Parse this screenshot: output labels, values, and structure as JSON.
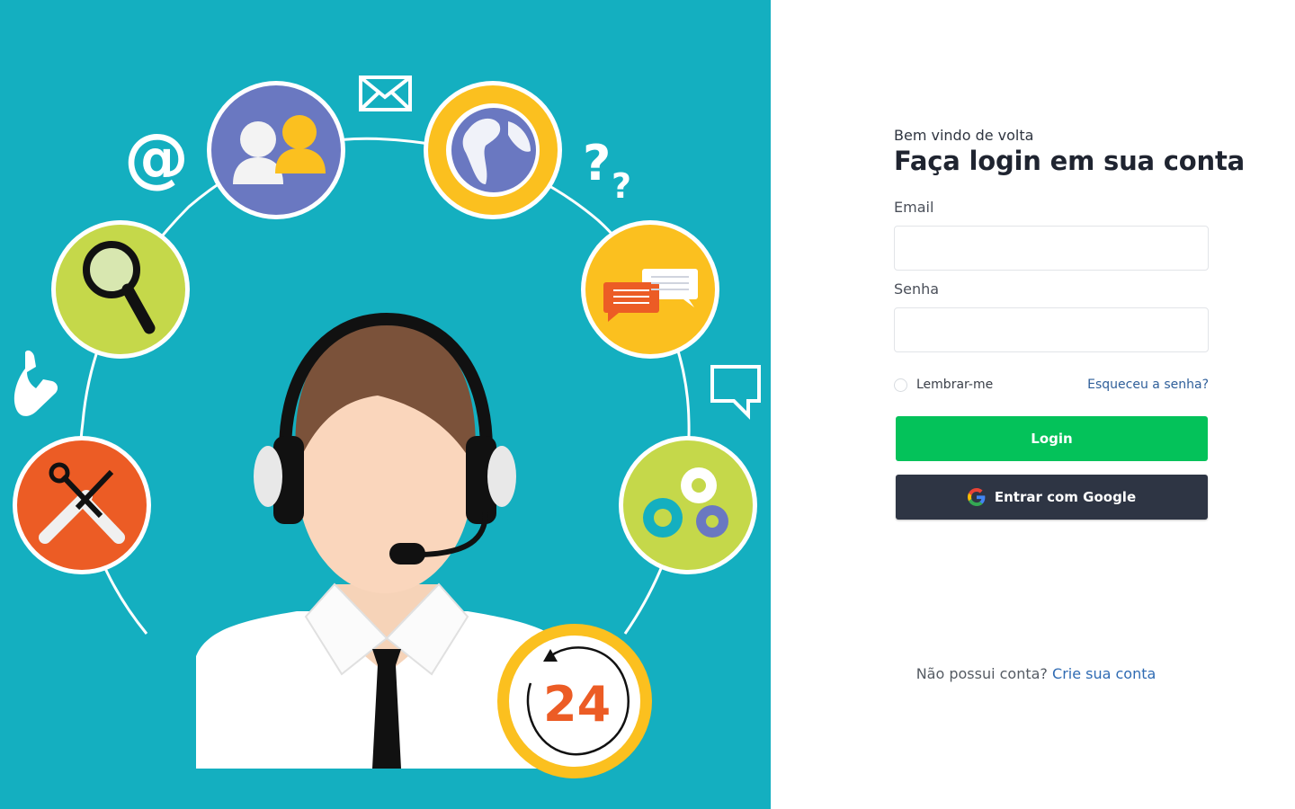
{
  "hero": {
    "alt_icons": [
      "email-icon",
      "at-sign-icon",
      "users-icon",
      "globe-icon",
      "question-icon",
      "search-icon",
      "chat-icon",
      "phone-icon",
      "speech-bubble-icon",
      "tools-icon",
      "gears-icon",
      "clock-24-icon",
      "support-agent-icon"
    ],
    "badge_text": "24",
    "colors": {
      "background": "#14afc0",
      "blue_circle": "#6a78c1",
      "yellow_circle": "#fbc01f",
      "green_circle": "#c5d84a",
      "orange_circle": "#ec5c25"
    }
  },
  "login": {
    "greeting": "Bem vindo de volta",
    "title": "Faça login em sua conta",
    "email_label": "Email",
    "email_value": "",
    "password_label": "Senha",
    "password_value": "",
    "remember_label": "Lembrar-me",
    "forgot_label": "Esqueceu a senha?",
    "login_button": "Login",
    "google_button": "Entrar com Google",
    "signup_prompt": "Não possui conta?",
    "signup_link": "Crie sua conta"
  },
  "colors": {
    "login_button": "#04c25a",
    "google_button": "#2e3544",
    "link": "#2f6bb3"
  }
}
